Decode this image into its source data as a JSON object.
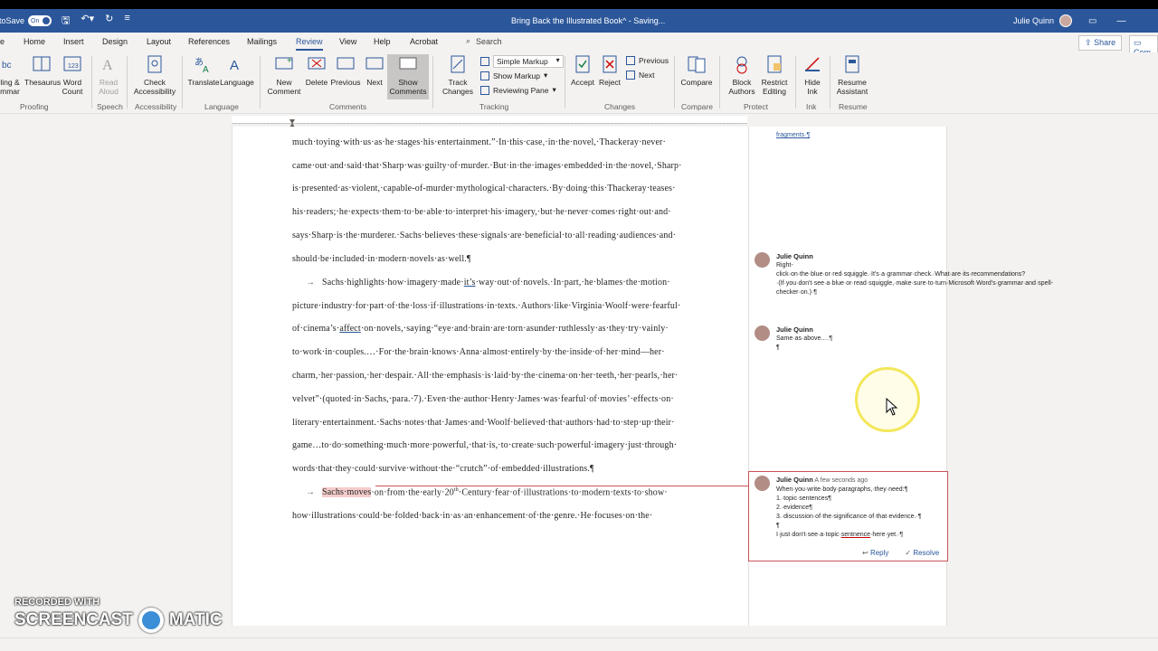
{
  "titlebar": {
    "autosave_label": "AutoSave",
    "autosave_state": "On",
    "doc_title": "Bring Back the Illustrated Book^ - Saving... ",
    "user_name": "Julie Quinn"
  },
  "tabs": [
    "Home",
    "Insert",
    "Design",
    "Layout",
    "References",
    "Mailings",
    "Review",
    "View",
    "Help",
    "Acrobat"
  ],
  "active_tab": "Review",
  "search_placeholder": "Search",
  "share_label": "Share",
  "comments_label": "Com",
  "ribbon": {
    "spelling": "ling &\nmmar",
    "thesaurus": "Thesaurus",
    "word_count": "Word\nCount",
    "read_aloud": "Read\nAloud",
    "check_accessibility": "Check\nAccessibility",
    "translate": "Translate",
    "language": "Language",
    "new_comment": "New\nComment",
    "delete": "Delete",
    "previous": "Previous",
    "next": "Next",
    "show_comments": "Show\nComments",
    "track_changes": "Track\nChanges",
    "simple_markup": "Simple Markup",
    "show_markup": "Show Markup",
    "reviewing_pane": "Reviewing Pane",
    "accept": "Accept",
    "reject": "Reject",
    "prev_change": "Previous",
    "next_change": "Next",
    "compare": "Compare",
    "block_authors": "Block\nAuthors",
    "restrict_editing": "Restrict\nEditing",
    "hide_ink": "Hide\nInk",
    "resume_assistant": "Resume\nAssistant",
    "groups": {
      "proofing": "Proofing",
      "speech": "Speech",
      "accessibility": "Accessibility",
      "language": "Language",
      "comments": "Comments",
      "tracking": "Tracking",
      "changes": "Changes",
      "compare": "Compare",
      "protect": "Protect",
      "ink": "Ink",
      "resume": "Resume"
    }
  },
  "document": {
    "lines": [
      "much·toying·with·us·as·he·stages·his·entertainment.”·In·this·case,·in·the·novel,·Thackeray·never·",
      "came·out·and·said·that·Sharp·was·guilty·of·murder.·But·in·the·images·embedded·in·the·novel,·Sharp·",
      "is·presented·as·violent,·capable-of-murder·mythological·characters.·By·doing·this·Thackeray·teases·",
      "his·readers;·he·expects·them·to·be·able·to·interpret·his·imagery,·but·he·never·comes·right·out·and·",
      "says·Sharp·is·the·murderer.·Sachs·believes·these·signals·are·beneficial·to·all·reading·audiences·and·",
      "should·be·included·in·modern·novels·as·well.¶"
    ],
    "p2_first": "Sachs·highlights·how·imagery·made·",
    "p2_its": "it’s",
    "p2_first_rest": "·way·out·of·novels.·In·part,·he·blames·the·motion·",
    "p2_lines": [
      "picture·industry·for·part·of·the·loss·if·illustrations·in·texts.·Authors·like·Virginia·Woolf·were·fearful·",
      "to·work·in·couples.…·For·the·brain·knows·Anna·almost·entirely·by·the·inside·of·her·mind—her·",
      "charm,·her·passion,·her·despair.·All·the·emphasis·is·laid·by·the·cinema·on·her·teeth,·her·pearls,·her·",
      "velvet”·(quoted·in·Sachs,·para.·7).·Even·the·author·Henry·James·was·fearful·of·movies’·effects·on·",
      "literary·entertainment.·Sachs·notes·that·James·and·Woolf·believed·that·authors·had·to·step·up·their·",
      "game…to·do·something·much·more·powerful,·that·is,·to·create·such·powerful·imagery·just·through·",
      "words·that·they·could·survive·without·the·“crutch”·of·embedded·illustrations.¶"
    ],
    "p2_l3_pre": "of·cinema’s·",
    "p2_l3_affect": "affect",
    "p2_l3_post": "·on·novels,·saying·“eye·and·brain·are·torn·asunder·ruthlessly·as·they·try·vainly·",
    "p3_highlight": "Sachs·moves",
    "p3_rest": "·on·from·the·early·20",
    "p3_sup": "th",
    "p3_rest2": "·Century·fear·of·illustrations·to·modern·texts·to·show·",
    "p3_line2": "how·illustrations·could·be·folded·back·in·as·an·enhancement·of·the·genre.·He·focuses·on·the·"
  },
  "comments": {
    "top_fragment": "fragments·¶",
    "c1_author": "Julie Quinn",
    "c1_text": "Right-click·on·the·blue·or·red·squiggle.·It's·a·grammar·check.·What·are·its·recommendations?·(If·you·don't·see·a·blue·or·read·squiggle,·make·sure·to·turn·Microsoft·Word's·grammar·and·spell-checker·on.)·¶",
    "c2_author": "Julie Quinn",
    "c2_text": "Same·as·above.…¶",
    "c2_text2": "¶",
    "c3_author": "Julie Quinn",
    "c3_time": "A few seconds ago",
    "c3_lines": [
      "When·you·write·body·paragraphs,·they·need:¶",
      "1.·topic·sentences¶",
      "2.·evidence¶",
      "3.·discussion·of·the·significance·of·that·evidence.·¶",
      "¶"
    ],
    "c3_last_pre": "I·just·don't·see·a·topic·",
    "c3_last_typo": "sentnence",
    "c3_last_post": "·here·yet.·¶",
    "reply": "Reply",
    "resolve": "Resolve"
  },
  "watermark": {
    "line1": "RECORDED WITH",
    "line2a": "SCREENCAST",
    "line2b": "MATIC"
  },
  "colors": {
    "accent": "#2b579a",
    "highlight": "#f4cccc",
    "active_comment_border": "#c8545b"
  }
}
